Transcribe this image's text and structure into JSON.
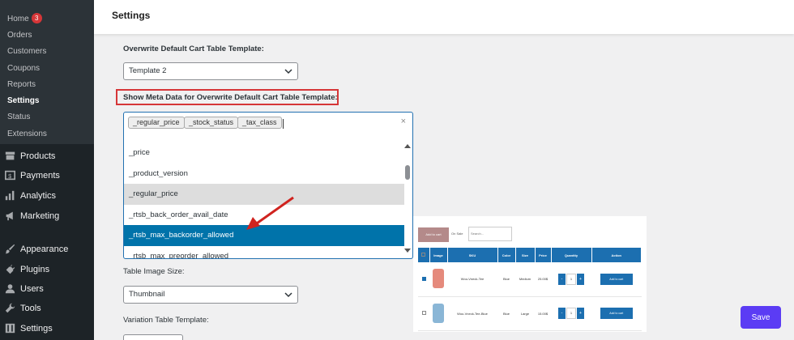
{
  "sidebar": {
    "submenu": [
      {
        "label": "Home",
        "badge": "3"
      },
      {
        "label": "Orders"
      },
      {
        "label": "Customers"
      },
      {
        "label": "Coupons"
      },
      {
        "label": "Reports"
      },
      {
        "label": "Settings"
      },
      {
        "label": "Status"
      },
      {
        "label": "Extensions"
      }
    ],
    "menu": [
      {
        "label": "Products",
        "icon": "archive-icon"
      },
      {
        "label": "Payments",
        "icon": "payments-icon"
      },
      {
        "label": "Analytics",
        "icon": "bar-chart-icon"
      },
      {
        "label": "Marketing",
        "icon": "megaphone-icon"
      },
      {
        "label": "Appearance",
        "icon": "brush-icon"
      },
      {
        "label": "Plugins",
        "icon": "plug-icon"
      },
      {
        "label": "Users",
        "icon": "user-icon"
      },
      {
        "label": "Tools",
        "icon": "wrench-icon"
      },
      {
        "label": "Settings",
        "icon": "settings-icon"
      }
    ]
  },
  "header": {
    "title": "Settings"
  },
  "form": {
    "cart_template_label": "Overwrite Default Cart Table Template:",
    "cart_template_value": "Template 2",
    "meta_label": "Show Meta Data for Overwrite Default Cart Table Template:",
    "meta_tags": [
      "_regular_price",
      "_stock_status",
      "_tax_class"
    ],
    "clear_symbol": "×",
    "meta_options": [
      "_price",
      "_product_version",
      "_regular_price",
      "_rtsb_back_order_avail_date",
      "_rtsb_max_backorder_allowed",
      "_rtsb_max_preorder_allowed"
    ],
    "image_size_label": "Table Image Size:",
    "image_size_value": "Thumbnail",
    "variation_label": "Variation Table Template:"
  },
  "save_label": "Save",
  "preview": {
    "add_to_cart": "Add to cart",
    "on_sale": "On Sale",
    "search_placeholder": "Search...",
    "columns": [
      "Image",
      "SKU",
      "Color",
      "Size",
      "Price",
      "Quantity",
      "Action"
    ],
    "rows": [
      {
        "sku": "Woo-Vneck-Tee",
        "color": "Blue",
        "size": "Medium",
        "price": "25.00$",
        "qty": "1",
        "checked": true,
        "thumb_color": "#e58a7c"
      },
      {
        "sku": "Woo-Vneck-Tee-Blue",
        "color": "Blue",
        "size": "Large",
        "price": "15.00$",
        "qty": "1",
        "checked": false,
        "thumb_color": "#8ab6d6"
      }
    ],
    "row_button": "Add to cart",
    "qty_minus": "-",
    "qty_plus": "+"
  },
  "colors": {
    "accent": "#0073aa",
    "save": "#5b3cf4",
    "highlight": "#d63638",
    "sidebar": "#1d2327"
  }
}
